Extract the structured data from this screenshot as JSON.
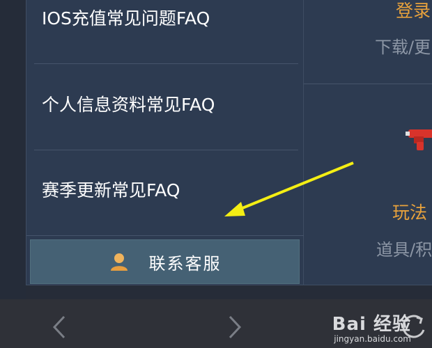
{
  "faq": {
    "items": [
      {
        "label": "IOS充值常见问题FAQ"
      },
      {
        "label": "个人信息资料常见FAQ"
      },
      {
        "label": "赛季更新常见FAQ"
      }
    ],
    "contact_label": "联系客服"
  },
  "right_panel": {
    "top_title": "登录",
    "top_subtitle": "下载/更",
    "bottom_title": "玩法",
    "bottom_subtitle": "道具/积"
  },
  "nav": {
    "prev_icon": "chevron-left-icon",
    "next_icon": "chevron-right-icon"
  },
  "watermark": {
    "brand": "Bai  经验",
    "url": "jingyan.baidu.com"
  },
  "colors": {
    "panel_bg": "#2d3b51",
    "accent_orange": "#e8a23c",
    "contact_bg": "#456174",
    "annotation_arrow": "#f4ee14"
  }
}
